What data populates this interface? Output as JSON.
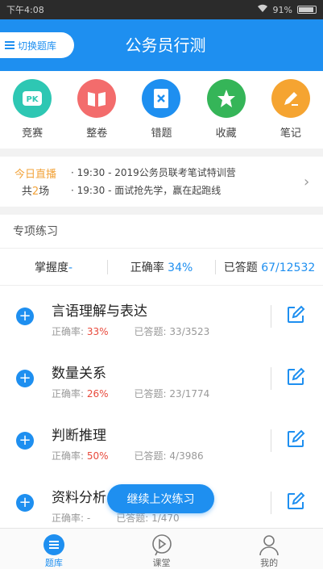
{
  "status": {
    "time": "下午4:08",
    "battery": "91%"
  },
  "header": {
    "switch_label": "切换题库",
    "title": "公务员行测",
    "accent": "#1e8ff0"
  },
  "categories": [
    {
      "label": "竞赛",
      "icon": "pk-icon",
      "color": "#2ec7b3",
      "glyph": "PK"
    },
    {
      "label": "整卷",
      "icon": "book-open-icon",
      "color": "#f36c6c",
      "glyph": ""
    },
    {
      "label": "错题",
      "icon": "wrong-book-icon",
      "color": "#1e8ff0",
      "glyph": ""
    },
    {
      "label": "收藏",
      "icon": "star-icon",
      "color": "#35b558",
      "glyph": ""
    },
    {
      "label": "笔记",
      "icon": "pencil-icon",
      "color": "#f5a431",
      "glyph": ""
    }
  ],
  "live": {
    "today": "今日直播",
    "count_prefix": "共",
    "count": "2",
    "count_suffix": "场",
    "items": [
      {
        "time": "19:30",
        "text": "- 2019公务员联考笔试特训营"
      },
      {
        "time": "19:30",
        "text": "- 面试抢先学，赢在起跑线"
      }
    ]
  },
  "practice": {
    "section_title": "专项练习",
    "mastery_label": "掌握度",
    "mastery_value": "-",
    "accuracy_label": "正确率",
    "accuracy_value": "34%",
    "answered_label": "已答题",
    "answered_value": "67/12532",
    "rows": [
      {
        "name": "言语理解与表达",
        "rate_label": "正确率:",
        "rate": "33%",
        "done_label": "已答题:",
        "done": "33/3523"
      },
      {
        "name": "数量关系",
        "rate_label": "正确率:",
        "rate": "26%",
        "done_label": "已答题:",
        "done": "23/1774"
      },
      {
        "name": "判断推理",
        "rate_label": "正确率:",
        "rate": "50%",
        "done_label": "已答题:",
        "done": "4/3986"
      },
      {
        "name": "资料分析",
        "rate_label": "正确率:",
        "rate": "-",
        "done_label": "已答题:",
        "done": "1/470"
      }
    ]
  },
  "fab_label": "继续上次练习",
  "tabs": [
    {
      "label": "题库",
      "icon": "list-icon",
      "active": true
    },
    {
      "label": "课堂",
      "icon": "play-icon",
      "active": false
    },
    {
      "label": "我的",
      "icon": "user-icon",
      "active": false
    }
  ]
}
